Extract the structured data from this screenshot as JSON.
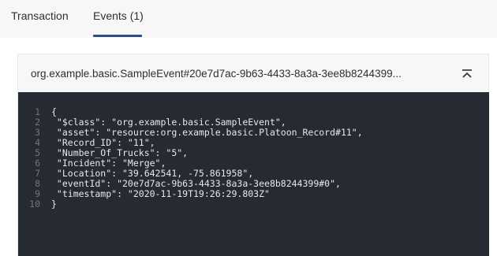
{
  "tabs": [
    {
      "label": "Transaction"
    },
    {
      "label": "Events (1)"
    }
  ],
  "event": {
    "title": "org.example.basic.SampleEvent#20e7d7ac-9b63-4433-8a3a-3ee8b8244399..."
  },
  "code": {
    "lines": [
      {
        "num": "1",
        "text": "{"
      },
      {
        "num": "2",
        "text": " \"$class\": \"org.example.basic.SampleEvent\","
      },
      {
        "num": "3",
        "text": " \"asset\": \"resource:org.example.basic.Platoon_Record#11\","
      },
      {
        "num": "4",
        "text": " \"Record_ID\": \"11\","
      },
      {
        "num": "5",
        "text": " \"Number_Of_Trucks\": \"5\","
      },
      {
        "num": "6",
        "text": " \"Incident\": \"Merge\","
      },
      {
        "num": "7",
        "text": " \"Location\": \"39.642541, -75.861958\","
      },
      {
        "num": "8",
        "text": " \"eventId\": \"20e7d7ac-9b63-4433-8a3a-3ee8b8244399#0\","
      },
      {
        "num": "9",
        "text": " \"timestamp\": \"2020-11-19T19:26:29.803Z\""
      },
      {
        "num": "10",
        "text": "}"
      }
    ]
  },
  "icons": {
    "collapse": "collapse-up-icon"
  },
  "colors": {
    "accent": "#2a4b8d",
    "code_bg": "#252a33",
    "header_bg": "#f7f7f8"
  }
}
